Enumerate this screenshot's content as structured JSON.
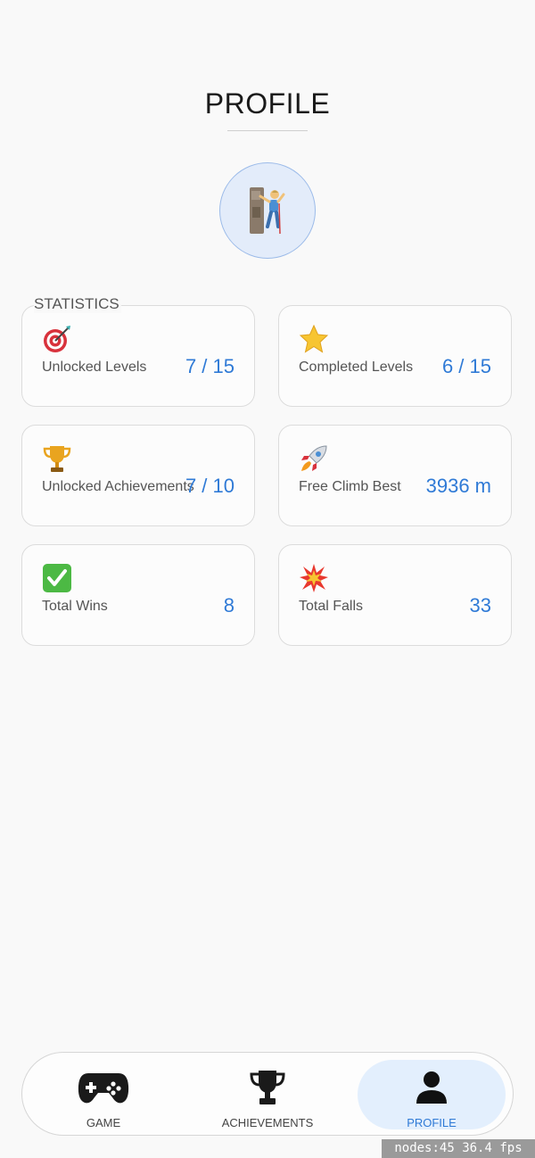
{
  "page": {
    "title": "PROFILE"
  },
  "avatar": {
    "icon": "rock-climber-icon"
  },
  "statistics": {
    "label": "STATISTICS",
    "cards": [
      {
        "icon": "target-icon",
        "label": "Unlocked Levels",
        "value": "7 / 15"
      },
      {
        "icon": "star-icon",
        "label": "Completed Levels",
        "value": "6 / 15"
      },
      {
        "icon": "trophy-icon",
        "label": "Unlocked Achievements",
        "value": "7 / 10"
      },
      {
        "icon": "rocket-icon",
        "label": "Free Climb Best",
        "value": "3936 m"
      },
      {
        "icon": "checkmark-icon",
        "label": "Total Wins",
        "value": "8"
      },
      {
        "icon": "explosion-icon",
        "label": "Total Falls",
        "value": "33"
      }
    ]
  },
  "nav": {
    "items": [
      {
        "label": "GAME",
        "icon": "gamepad-icon",
        "active": false
      },
      {
        "label": "ACHIEVEMENTS",
        "icon": "trophy-icon",
        "active": false
      },
      {
        "label": "PROFILE",
        "icon": "person-icon",
        "active": true
      }
    ],
    "accent": "#2f7ad6"
  },
  "debug": {
    "text": "nodes:45  36.4 fps"
  }
}
